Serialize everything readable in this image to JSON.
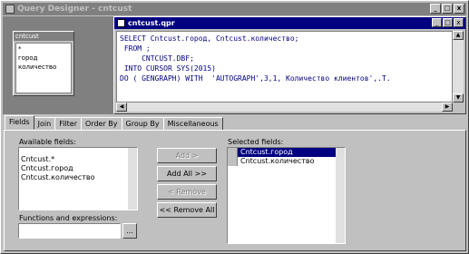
{
  "window": {
    "title": "Query Designer - cntcust"
  },
  "titlebar_buttons": [
    "_",
    "□",
    "x"
  ],
  "table_window": {
    "title": "cntcust",
    "fields": [
      "*",
      "город",
      "количество"
    ]
  },
  "query_window": {
    "title": "cntcust.qpr",
    "code_lines": [
      "SELECT Cntcust.город, Cntcust.количество;",
      " FROM ;",
      "     CNTCUST.DBF;",
      " INTO CURSOR SYS(2015)",
      "DO ( GENGRAPH) WITH  'AUTOGRAPH',3,1, Количество клиентов',.T."
    ]
  },
  "tabs": [
    "Fields",
    "Join",
    "Filter",
    "Order By",
    "Group By",
    "Miscellaneous"
  ],
  "fields_panel": {
    "available_label": "Available fields:",
    "available_items": [
      "Cntcust.*",
      "Cntcust.город",
      "Cntcust.количество"
    ],
    "functions_label": "Functions and expressions:",
    "ellipsis": "...",
    "buttons": {
      "add": "Add >",
      "add_all": "Add All >>",
      "remove": "< Remove",
      "remove_all": "<< Remove All"
    },
    "selected_label": "Selected fields:",
    "selected_items": [
      "Cntcust.город",
      "Cntcust.количество"
    ]
  }
}
